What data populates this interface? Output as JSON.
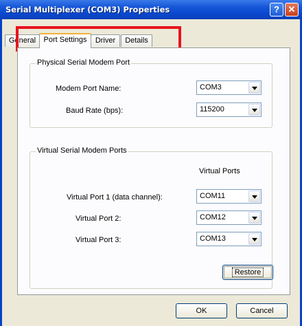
{
  "window": {
    "title": "Serial Multiplexer (COM3) Properties"
  },
  "titlebar_buttons": {
    "help": "?",
    "close": "✕"
  },
  "tabs": [
    {
      "label": "General"
    },
    {
      "label": "Port Settings"
    },
    {
      "label": "Driver"
    },
    {
      "label": "Details"
    }
  ],
  "physical": {
    "title": "Physical Serial Modem Port",
    "port_name_label": "Modem Port Name:",
    "port_name_value": "COM3",
    "baud_label": "Baud Rate (bps):",
    "baud_value": "115200"
  },
  "virtual": {
    "title": "Virtual Serial Modem Ports",
    "column_header": "Virtual Ports",
    "ports": [
      {
        "label": "Virtual Port 1 (data channel):",
        "value": "COM11"
      },
      {
        "label": "Virtual Port 2:",
        "value": "COM12"
      },
      {
        "label": "Virtual Port 3:",
        "value": "COM13"
      }
    ]
  },
  "buttons": {
    "restore": "Restore",
    "ok": "OK",
    "cancel": "Cancel"
  },
  "colors": {
    "highlight_border": "#e8141e",
    "titlebar": "#0a49cf"
  }
}
